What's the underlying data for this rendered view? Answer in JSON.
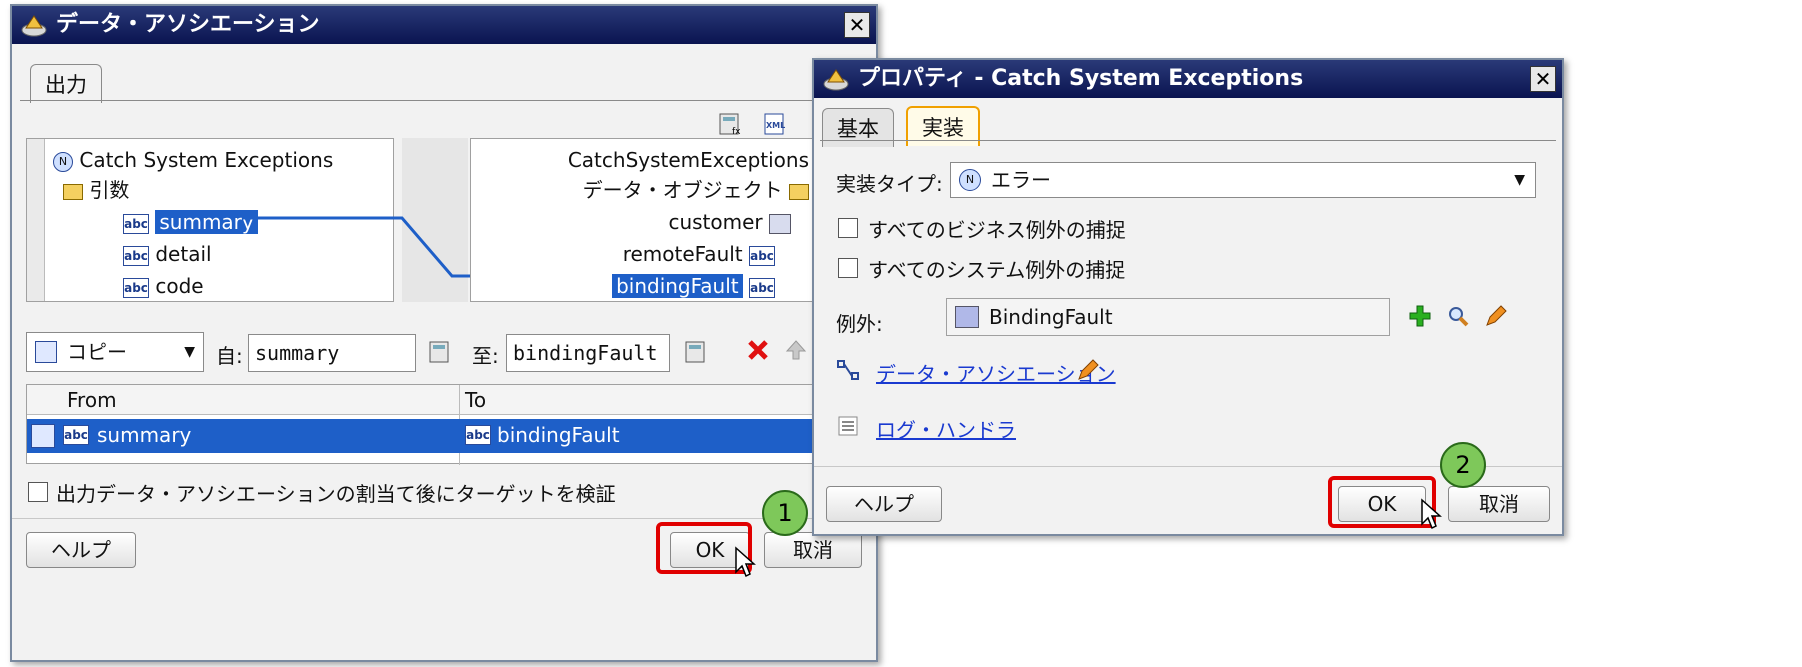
{
  "dialog1": {
    "title": "データ・アソシエーション",
    "close": "✕",
    "tab_output": "出力",
    "source_tree": {
      "root": "Catch System Exceptions",
      "folder": "引数",
      "items": [
        "summary",
        "detail",
        "code"
      ],
      "selected": "summary"
    },
    "target_tree": {
      "root": "CatchSystemExceptions",
      "folder": "データ・オブジェクト",
      "items": [
        "customer",
        "remoteFault",
        "bindingFault"
      ],
      "selected": "bindingFault"
    },
    "operation_select": "コピー",
    "from_label": "自:",
    "from_value": "summary",
    "to_label": "至:",
    "to_value": "bindingFault",
    "table": {
      "headers": [
        "From",
        "To"
      ],
      "rows": [
        {
          "from": "summary",
          "to": "bindingFault"
        }
      ]
    },
    "verify_label": "出力データ・アソシエーションの割当て後にターゲットを検証",
    "help": "ヘルプ",
    "ok": "OK",
    "cancel": "取消"
  },
  "dialog2": {
    "title": "プロパティ - Catch System Exceptions",
    "close": "✕",
    "tabs": [
      "基本",
      "実装"
    ],
    "active_tab": "実装",
    "impl_type_label": "実装タイプ:",
    "impl_type_value": "エラー",
    "catch_business": "すべてのビジネス例外の捕捉",
    "catch_system": "すべてのシステム例外の捕捉",
    "exception_label": "例外:",
    "exception_value": "BindingFault",
    "data_association_link": "データ・アソシエーション",
    "log_handler_link": "ログ・ハンドラ",
    "help": "ヘルプ",
    "ok": "OK",
    "cancel": "取消"
  },
  "callouts": [
    "1",
    "2"
  ],
  "abc_icon": "abc",
  "colors": {
    "selection": "#1e5fc8",
    "title_bar": "#0a1450",
    "highlight_box": "#e00000",
    "callout": "#7ec85a"
  }
}
